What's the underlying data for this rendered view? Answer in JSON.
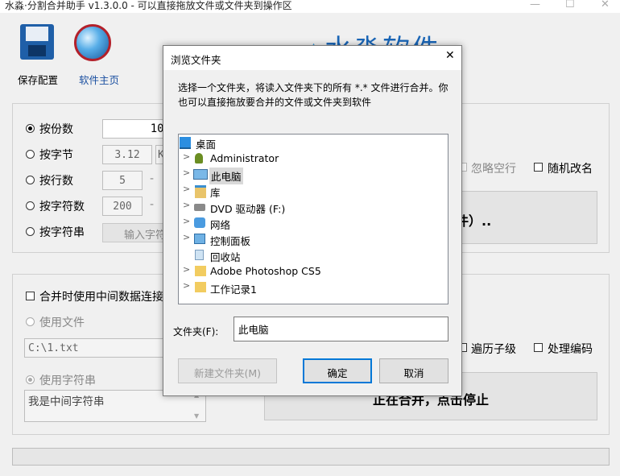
{
  "window": {
    "title": "水淼·分割合并助手 v1.3.0.0 - 可以直接拖放文件或文件夹到操作区",
    "minimize": "—",
    "maximize": "☐",
    "close": "✕"
  },
  "toolbar": {
    "save_label": "保存配置",
    "home_label": "软件主页",
    "brand_text": "水淼软件"
  },
  "split": {
    "by_count": {
      "label": "按份数",
      "value": "100"
    },
    "by_bytes": {
      "label": "按字节",
      "value": "3.12",
      "unit": "K"
    },
    "by_lines": {
      "label": "按行数",
      "value": "5",
      "dash": "-"
    },
    "by_chars": {
      "label": "按字符数",
      "value": "200",
      "dash": "-"
    },
    "by_string": {
      "label": "按字符串",
      "button": "输入字符"
    },
    "ignore_blank": "忽略空行",
    "random_rename": "随机改名",
    "big_button_text": "件）.."
  },
  "merge": {
    "use_intermediate": "合并时使用中间数据连接",
    "use_file": "使用文件",
    "file_path": "C:\\1.txt",
    "use_string": "使用字符串",
    "string_value": "我是中间字符串",
    "traverse_sub": "遍历子级",
    "handle_encoding": "处理编码",
    "big_button_text": "正在合并，点击停止"
  },
  "dialog": {
    "title": "浏览文件夹",
    "close": "✕",
    "description": "选择一个文件夹，将读入文件夹下的所有 *.* 文件进行合并。你也可以直接拖放要合并的文件或文件夹到软件",
    "tree": [
      {
        "label": "桌面",
        "expandable": false,
        "icon": "desktop-icon",
        "selected": false
      },
      {
        "label": "Administrator",
        "expandable": true,
        "icon": "user-icon",
        "selected": false
      },
      {
        "label": "此电脑",
        "expandable": true,
        "icon": "computer-icon",
        "selected": true
      },
      {
        "label": "库",
        "expandable": true,
        "icon": "library-icon",
        "selected": false
      },
      {
        "label": "DVD 驱动器 (F:)",
        "expandable": true,
        "icon": "dvd-icon",
        "selected": false
      },
      {
        "label": "网络",
        "expandable": true,
        "icon": "network-icon",
        "selected": false
      },
      {
        "label": "控制面板",
        "expandable": true,
        "icon": "control-panel-icon",
        "selected": false
      },
      {
        "label": "回收站",
        "expandable": false,
        "icon": "recycle-bin-icon",
        "selected": false
      },
      {
        "label": "Adobe Photoshop CS5",
        "expandable": true,
        "icon": "folder-icon",
        "selected": false
      },
      {
        "label": "工作记录1",
        "expandable": true,
        "icon": "folder-icon",
        "selected": false
      }
    ],
    "folder_label": "文件夹(F):",
    "folder_value": "此电脑",
    "new_folder": "新建文件夹(M)",
    "ok": "确定",
    "cancel": "取消"
  }
}
